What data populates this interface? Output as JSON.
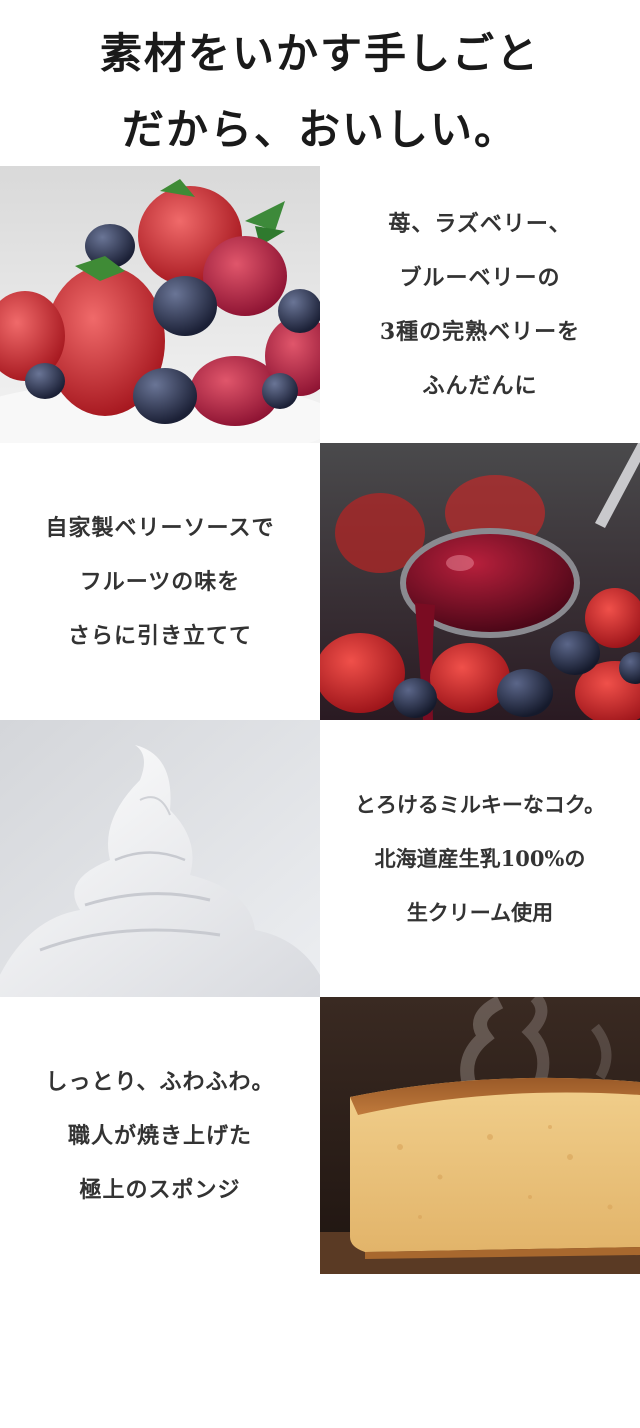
{
  "heading": {
    "line1": "素材をいかす手しごと",
    "line2": "だから、おいしい。"
  },
  "features": [
    {
      "lines": [
        "苺、ラズベリー、",
        "ブルーベリーの",
        "3種の完熟ベリーを",
        "ふんだんに"
      ],
      "image": "mixed-berries-photo"
    },
    {
      "lines": [
        "自家製ベリーソースで",
        "フルーツの味を",
        "さらに引き立てて"
      ],
      "image": "berry-sauce-spoon-photo"
    },
    {
      "lines": [
        "とろけるミルキーなコク。",
        "北海道産生乳100%の",
        "生クリーム使用"
      ],
      "image": "whipped-cream-photo"
    },
    {
      "lines": [
        "しっとり、ふわふわ。",
        "職人が焼き上げた",
        "極上のスポンジ"
      ],
      "image": "sponge-cake-photo"
    }
  ]
}
